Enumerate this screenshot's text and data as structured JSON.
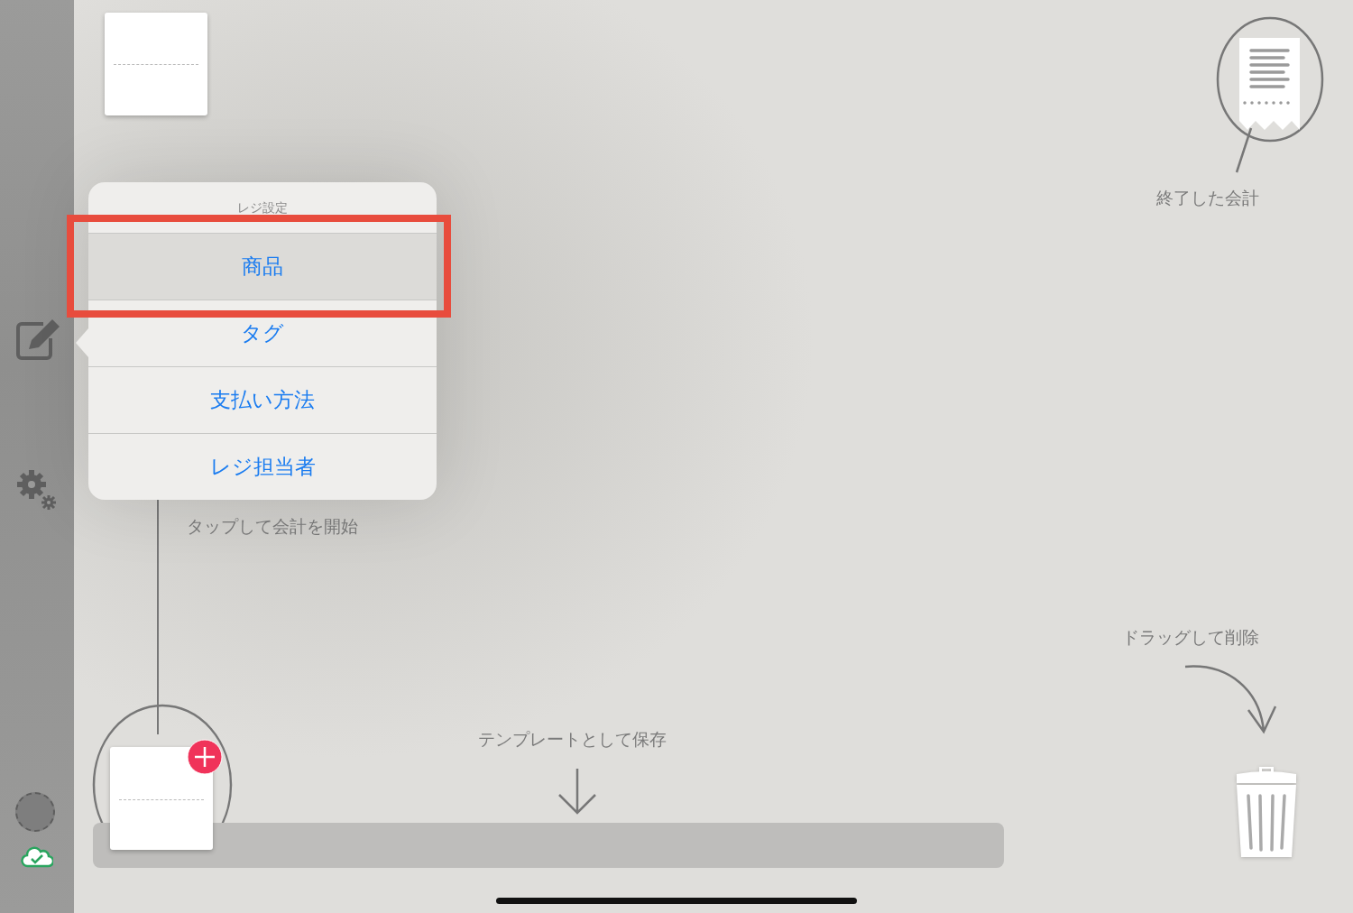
{
  "popover": {
    "title": "レジ設定",
    "items": [
      {
        "label": "商品",
        "selected": true
      },
      {
        "label": "タグ",
        "selected": false
      },
      {
        "label": "支払い方法",
        "selected": false
      },
      {
        "label": "レジ担当者",
        "selected": false
      }
    ]
  },
  "hints": [
    {
      "kind": "finished",
      "text": "終了した会計"
    },
    {
      "kind": "start",
      "text": "タップして会計を開始"
    },
    {
      "kind": "delete",
      "text": "ドラッグして削除"
    },
    {
      "kind": "template",
      "text": "テンプレートとして保存"
    }
  ]
}
